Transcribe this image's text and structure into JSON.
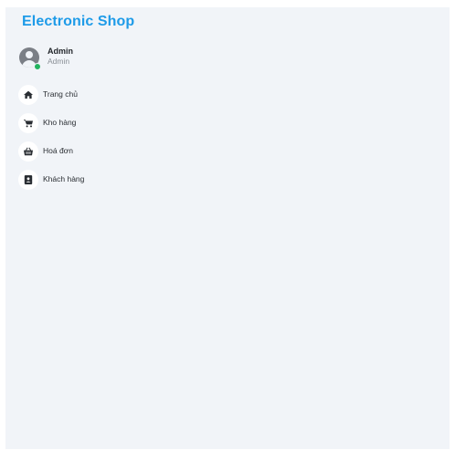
{
  "app": {
    "brand": "Electronic Shop"
  },
  "profile": {
    "name": "Admin",
    "role": "Admin"
  },
  "nav": {
    "items": [
      {
        "label": "Trang chủ",
        "icon": "home-icon"
      },
      {
        "label": "Kho hàng",
        "icon": "cart-icon"
      },
      {
        "label": "Hoá đơn",
        "icon": "basket-icon"
      },
      {
        "label": "Khách hàng",
        "icon": "contact-card-icon"
      }
    ]
  },
  "colors": {
    "brand": "#1e9be8",
    "background": "#f1f4f8",
    "online": "#23b35f"
  }
}
